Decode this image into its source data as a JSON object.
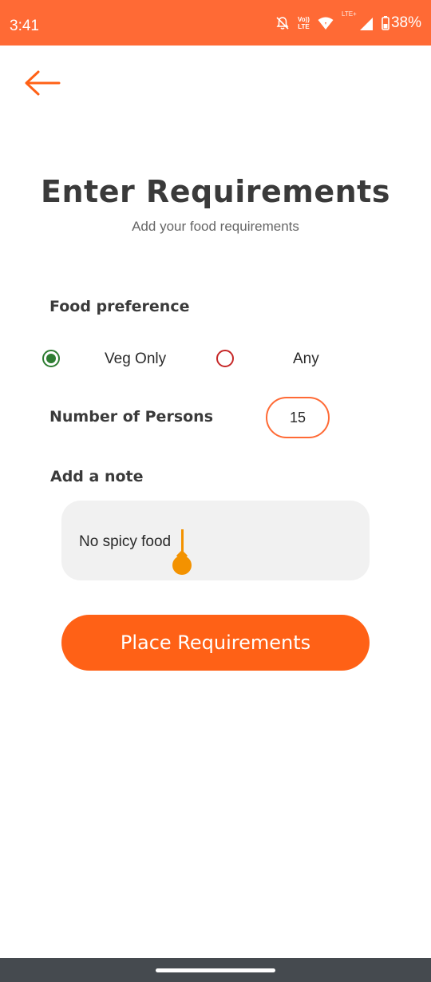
{
  "status_bar": {
    "time": "3:41",
    "network_label_top": "Vo))",
    "network_label_bottom": "LTE",
    "signal_label": "LTE+",
    "battery_percent": "38%",
    "background_color": "#ff6a35"
  },
  "header": {
    "back_icon": "arrow-left-icon",
    "title": "Enter Requirements",
    "subtitle": "Add your food requirements"
  },
  "form": {
    "food_preference_label": "Food preference",
    "options": [
      {
        "label": "Veg Only",
        "selected": true,
        "color": "#2e7d32"
      },
      {
        "label": "Any",
        "selected": false,
        "color": "#c62828"
      }
    ],
    "persons_label": "Number of Persons",
    "persons_value": "15",
    "note_label": "Add a note",
    "note_value": "No spicy food"
  },
  "actions": {
    "submit_label": "Place Requirements",
    "accent_color": "#ff6116"
  }
}
